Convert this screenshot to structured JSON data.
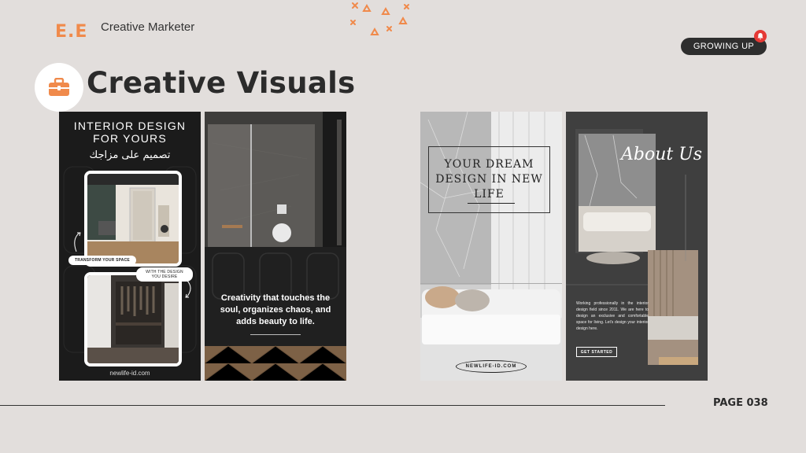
{
  "header": {
    "logo": "E.E",
    "brand": "Creative Marketer",
    "badge": "GROWING UP"
  },
  "title": "Creative Visuals",
  "icons": {
    "title_icon": "briefcase-icon",
    "badge_icon": "bell-icon",
    "accent": "#f08a4b"
  },
  "slides": {
    "interior": {
      "heading_1": "INTERIOR DESIGN",
      "heading_2": "FOR YOURS",
      "arabic": "تصميم على مزاجك",
      "tag_1": "TRANSFORM YOUR SPACE",
      "tag_2": "WITH THE DESIGN YOU DESIRE",
      "footer": "newlife-id.com"
    },
    "quote": {
      "text": "Creativity that touches the soul, organizes chaos, and adds beauty to life."
    },
    "dream": {
      "title": "YOUR DREAM DESIGN IN NEW LIFE",
      "url": "NEWLIFE-ID.COM"
    },
    "about": {
      "heading": "About Us",
      "body": "Working professionally in the interior design field since 2011. We are here to design an exclusive and comfortable space for living. Let's design your interior design here.",
      "button": "GET STARTED"
    }
  },
  "footer": {
    "page": "PAGE 038"
  }
}
